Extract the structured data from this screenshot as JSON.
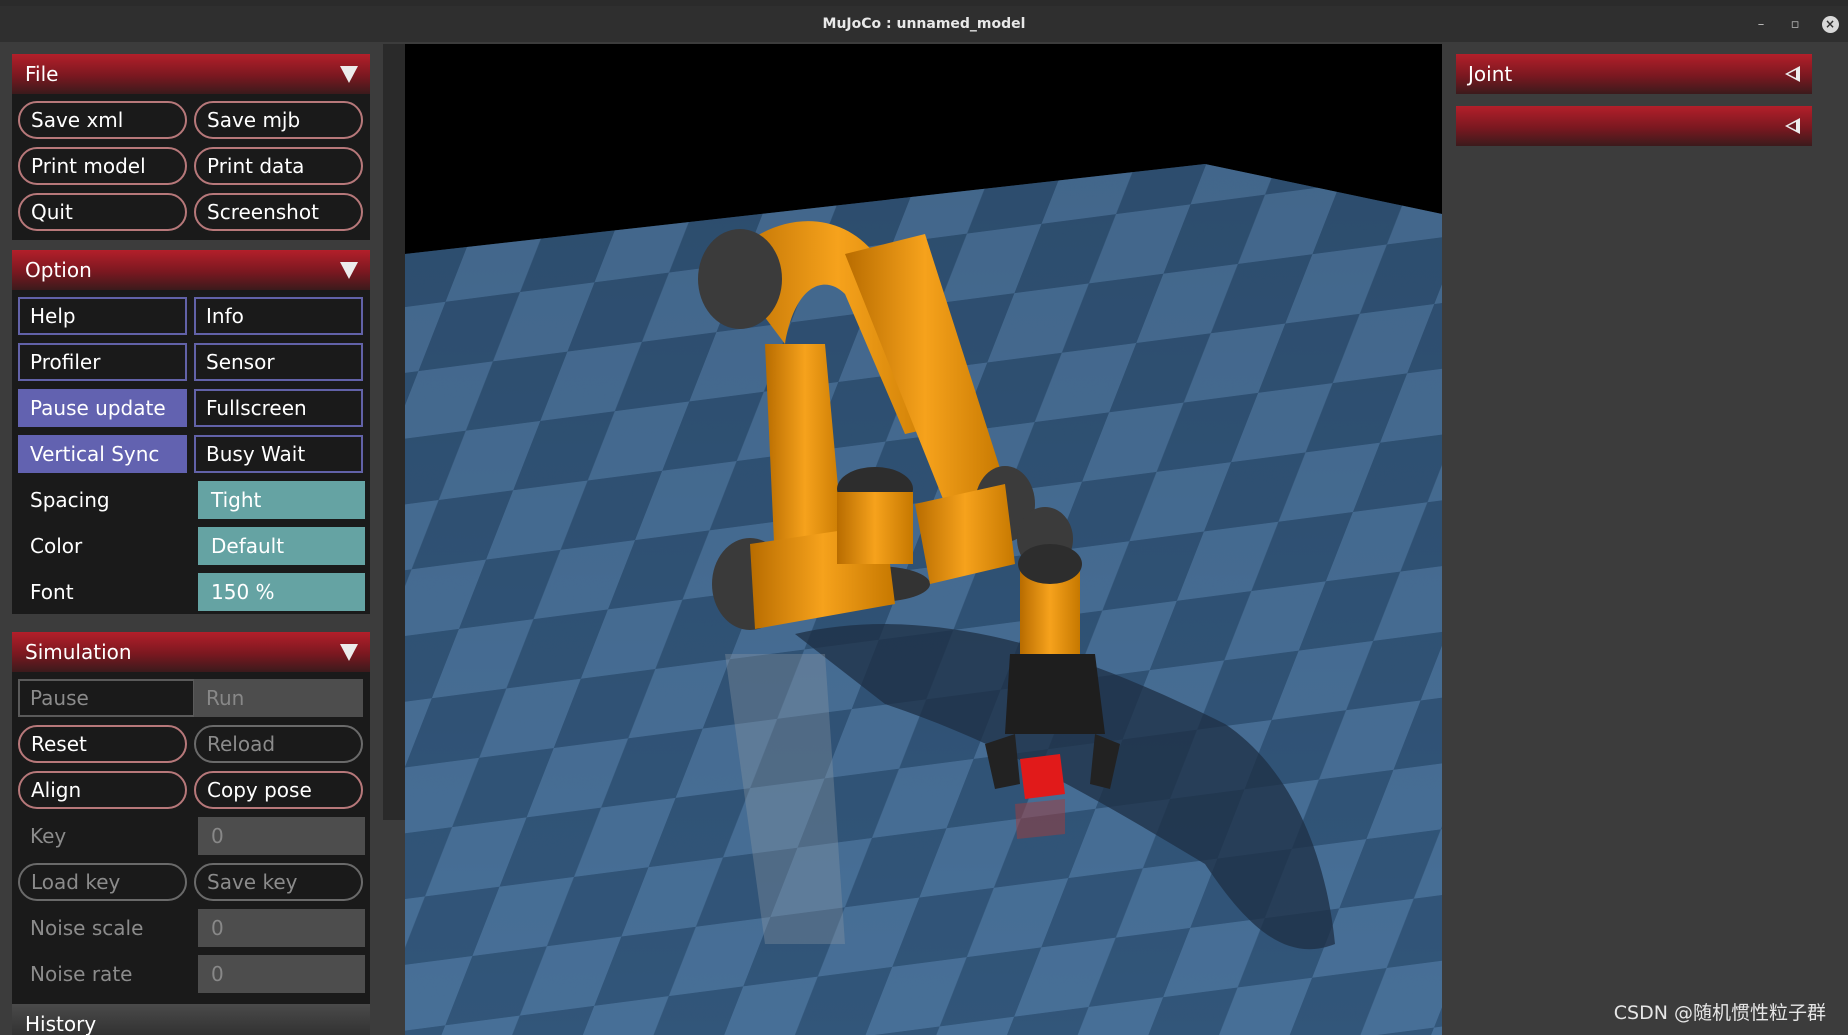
{
  "window": {
    "title": "MuJoCo : unnamed_model",
    "minimize_glyph": "–",
    "restore_glyph": "▫",
    "close_glyph": "×"
  },
  "colors": {
    "header_red": "#b31f2a",
    "toggle_on": "#6262b0",
    "select_teal": "#65a3a3",
    "button_border": "#b7787a"
  },
  "file": {
    "title": "File",
    "buttons": [
      "Save xml",
      "Save mjb",
      "Print model",
      "Print data",
      "Quit",
      "Screenshot"
    ]
  },
  "option": {
    "title": "Option",
    "toggles": [
      {
        "label": "Help",
        "on": false
      },
      {
        "label": "Info",
        "on": false
      },
      {
        "label": "Profiler",
        "on": false
      },
      {
        "label": "Sensor",
        "on": false
      },
      {
        "label": "Pause update",
        "on": true
      },
      {
        "label": "Fullscreen",
        "on": false
      },
      {
        "label": "Vertical Sync",
        "on": true
      },
      {
        "label": "Busy Wait",
        "on": false
      }
    ],
    "spacing": {
      "label": "Spacing",
      "value": "Tight"
    },
    "color": {
      "label": "Color",
      "value": "Default"
    },
    "font": {
      "label": "Font",
      "value": "150 %"
    }
  },
  "simulation": {
    "title": "Simulation",
    "pause": "Pause",
    "run": "Run",
    "reset": "Reset",
    "reload": "Reload",
    "align": "Align",
    "copy_pose": "Copy pose",
    "key": {
      "label": "Key",
      "value": "0"
    },
    "load_key": "Load key",
    "save_key": "Save key",
    "noise_scale": {
      "label": "Noise scale",
      "value": "0"
    },
    "noise_rate": {
      "label": "Noise rate",
      "value": "0"
    }
  },
  "history": {
    "title": "History"
  },
  "right_panel": {
    "joint_title": "Joint",
    "second_title": ""
  },
  "watermark": "CSDN @随机惯性粒子群"
}
